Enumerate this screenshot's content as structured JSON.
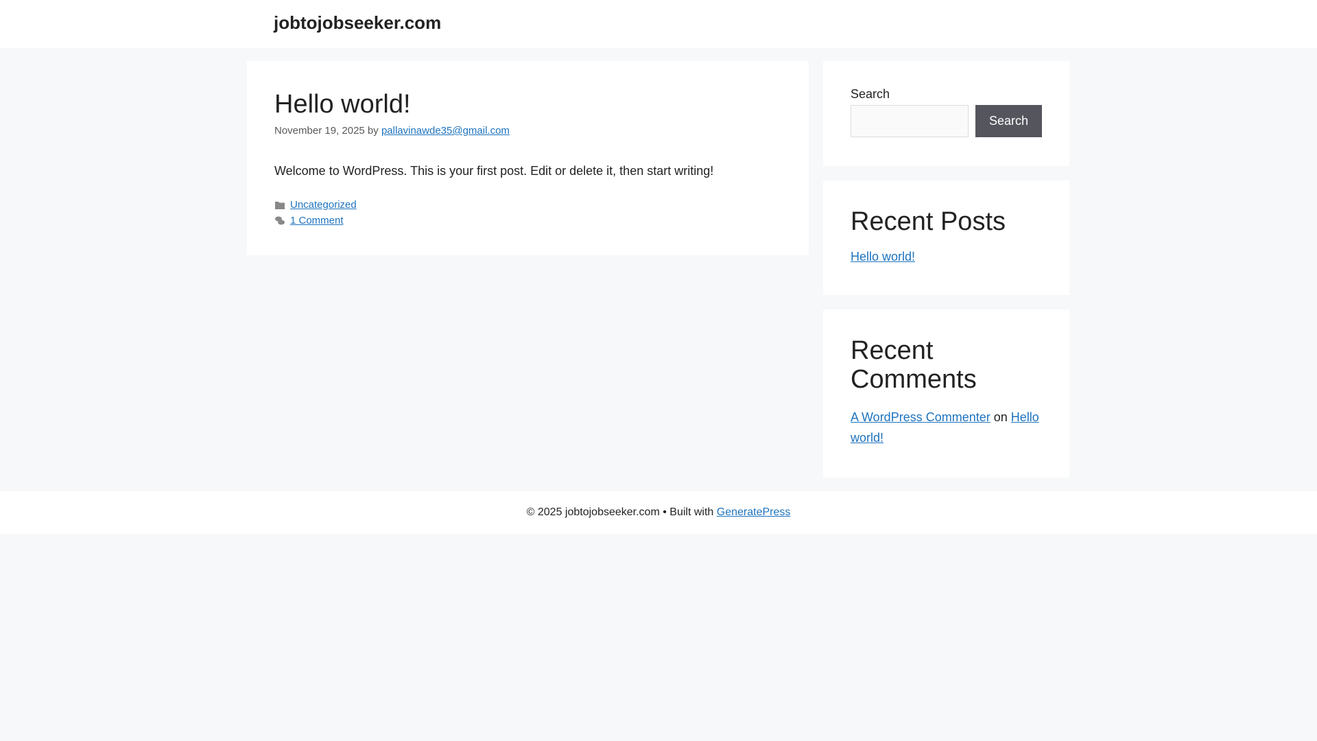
{
  "header": {
    "site_title": "jobtojobseeker.com"
  },
  "post": {
    "title": "Hello world!",
    "date": "November 19, 2025",
    "by": "by",
    "author": "pallavinawde35@gmail.com",
    "content": "Welcome to WordPress. This is your first post. Edit or delete it, then start writing!",
    "category": "Uncategorized",
    "comments": "1 Comment"
  },
  "sidebar": {
    "search": {
      "label": "Search",
      "button": "Search",
      "value": ""
    },
    "recent_posts": {
      "title": "Recent Posts",
      "items": [
        "Hello world!"
      ]
    },
    "recent_comments": {
      "title": "Recent Comments",
      "author": "A WordPress Commenter",
      "on": "on",
      "post": "Hello world!"
    }
  },
  "footer": {
    "copyright": "© 2025 jobtojobseeker.com • Built with",
    "link": "GeneratePress"
  },
  "colors": {
    "link": "#1e73be",
    "button": "#55555e",
    "background": "#f7f8f9"
  }
}
